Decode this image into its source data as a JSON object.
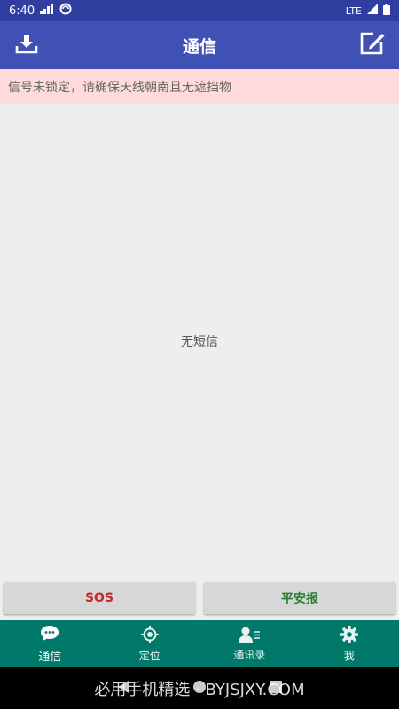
{
  "status": {
    "time": "6:40",
    "network": "LTE"
  },
  "appbar": {
    "title": "通信"
  },
  "warning": {
    "text": "信号未锁定，请确保天线朝南且无遮挡物"
  },
  "content": {
    "empty_text": "无短信"
  },
  "actions": {
    "sos_label": "SOS",
    "sos_color": "#c62828",
    "safe_label": "平安报",
    "safe_color": "#2e7d32"
  },
  "nav": {
    "items": [
      {
        "label": "通信",
        "icon": "chat-bubble-icon",
        "active": true
      },
      {
        "label": "定位",
        "icon": "location-target-icon",
        "active": false
      },
      {
        "label": "通讯录",
        "icon": "contacts-icon",
        "active": false
      },
      {
        "label": "我",
        "icon": "gear-icon",
        "active": false
      }
    ]
  },
  "watermark": {
    "text": "必用手机精选 · BYJSJXY.COM"
  },
  "colors": {
    "statusbar": "#303f9f",
    "appbar": "#3f51b5",
    "warning_bg": "#ffdada",
    "bottom_nav": "#00796b"
  }
}
